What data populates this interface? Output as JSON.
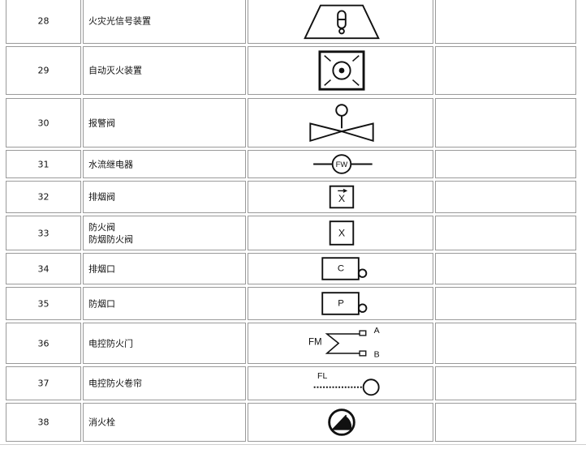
{
  "rows": [
    {
      "no": "28",
      "name": [
        "火灾光信号装置"
      ],
      "icon": "flame-light-signal-icon"
    },
    {
      "no": "29",
      "name": [
        "自动灭火装置"
      ],
      "icon": "auto-extinguisher-icon"
    },
    {
      "no": "30",
      "name": [
        "报警阀"
      ],
      "icon": "alarm-valve-icon"
    },
    {
      "no": "31",
      "name": [
        "水流继电器"
      ],
      "icon": "flow-relay-icon",
      "sym_text": "FW"
    },
    {
      "no": "32",
      "name": [
        "排烟阀"
      ],
      "icon": "smoke-exhaust-valve-icon",
      "sym_text": "X"
    },
    {
      "no": "33",
      "name": [
        "防火阀",
        "防烟防火阀"
      ],
      "icon": "fire-damper-icon",
      "sym_text": "X"
    },
    {
      "no": "34",
      "name": [
        "排烟口"
      ],
      "icon": "smoke-outlet-icon",
      "sym_text": "C"
    },
    {
      "no": "35",
      "name": [
        "防烟口"
      ],
      "icon": "smoke-prevention-outlet-icon",
      "sym_text": "P"
    },
    {
      "no": "36",
      "name": [
        "电控防火门"
      ],
      "icon": "electric-fire-door-icon",
      "sym_text": "FM",
      "sym_text_a": "A",
      "sym_text_b": "B"
    },
    {
      "no": "37",
      "name": [
        "电控防火卷帘"
      ],
      "icon": "electric-fire-shutter-icon",
      "sym_text": "FL"
    },
    {
      "no": "38",
      "name": [
        "消火栓"
      ],
      "icon": "fire-hydrant-icon"
    }
  ]
}
